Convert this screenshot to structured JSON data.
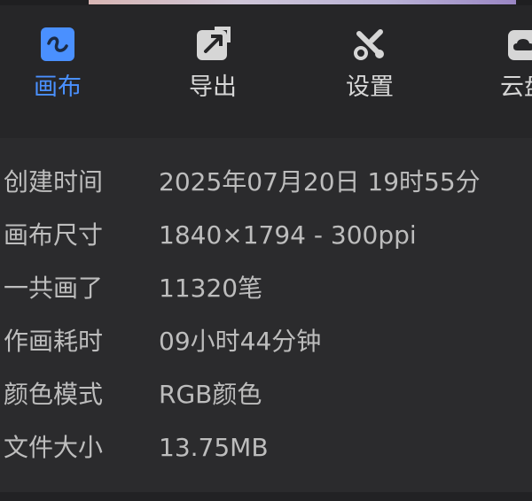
{
  "tabs": [
    {
      "label": "画布",
      "icon": "canvas-icon",
      "active": true
    },
    {
      "label": "导出",
      "icon": "export-icon",
      "active": false
    },
    {
      "label": "设置",
      "icon": "settings-icon",
      "active": false
    },
    {
      "label": "云盘",
      "icon": "cloud-drive-icon",
      "active": false
    }
  ],
  "info": [
    {
      "key": "创建时间",
      "value": "2025年07月20日 19时55分"
    },
    {
      "key": "画布尺寸",
      "value": "1840×1794 - 300ppi"
    },
    {
      "key": "一共画了",
      "value": "11320笔"
    },
    {
      "key": "作画耗时",
      "value": "09小时44分钟"
    },
    {
      "key": "颜色模式",
      "value": "RGB颜色"
    },
    {
      "key": "文件大小",
      "value": "13.75MB"
    }
  ],
  "colors": {
    "accent": "#4a90ff",
    "background": "#2b2b2d",
    "text": "#bdbdbd"
  }
}
